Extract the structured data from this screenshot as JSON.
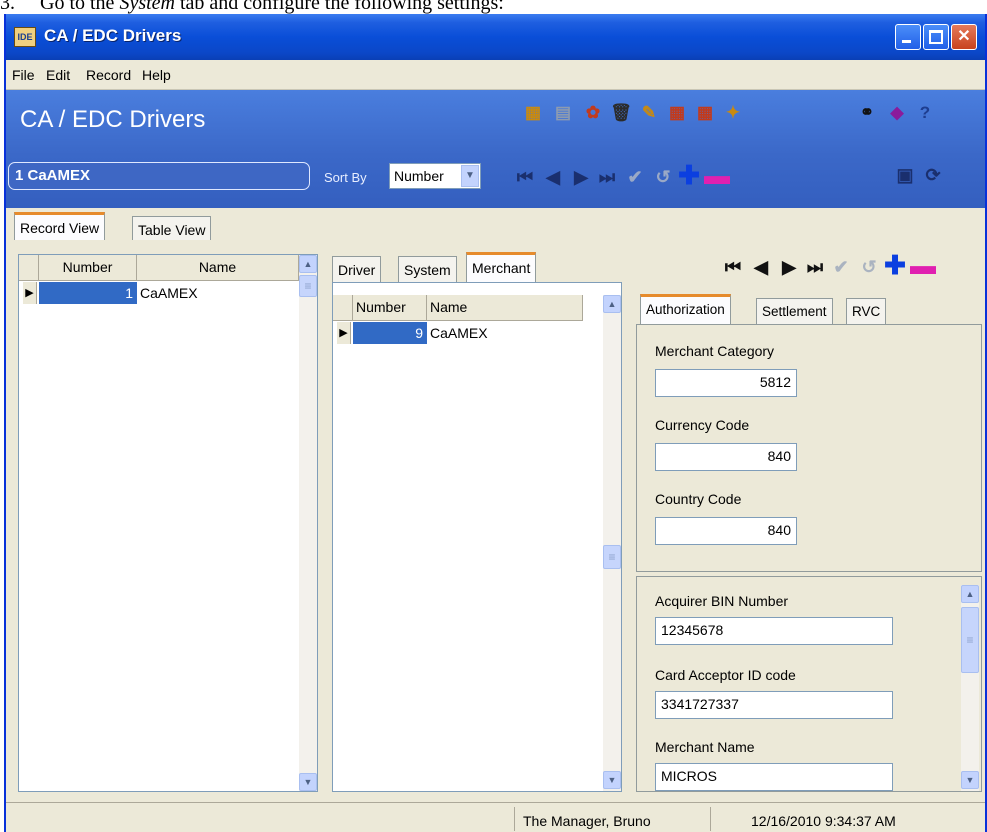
{
  "doc_caption": {
    "number": "3.",
    "before": "Go to the ",
    "italic": "System",
    "after": " tab and configure the following settings:"
  },
  "window": {
    "title": "CA / EDC Drivers",
    "icon_text": "IDE"
  },
  "menu": [
    "File",
    "Edit",
    "Record",
    "Help"
  ],
  "header": {
    "title": "CA / EDC Drivers",
    "current_record": "1 CaAMEX",
    "sort_by_label": "Sort By",
    "sort_by_value": "Number"
  },
  "view_tabs": [
    "Record View",
    "Table View"
  ],
  "left_grid": {
    "columns": [
      "Number",
      "Name"
    ],
    "rows": [
      {
        "number": "1",
        "name": "CaAMEX"
      }
    ]
  },
  "detail_tabs": [
    "Driver",
    "System",
    "Merchant"
  ],
  "merchant_grid": {
    "columns": [
      "Number",
      "Name"
    ],
    "rows": [
      {
        "number": "9",
        "name": "CaAMEX"
      }
    ]
  },
  "settings_tabs": [
    "Authorization",
    "Settlement",
    "RVC"
  ],
  "authorization": {
    "merchant_category_label": "Merchant Category",
    "merchant_category": "5812",
    "currency_code_label": "Currency Code",
    "currency_code": "840",
    "country_code_label": "Country Code",
    "country_code": "840"
  },
  "acquirer": {
    "bin_label": "Acquirer BIN Number",
    "bin": "12345678",
    "card_acceptor_label": "Card Acceptor ID code",
    "card_acceptor": "3341727337",
    "merchant_name_label": "Merchant Name",
    "merchant_name": "MICROS"
  },
  "status": {
    "user": "The Manager, Bruno",
    "datetime": "12/16/2010 9:34:37 AM"
  },
  "colors": {
    "title_bar": "#0a4ed8",
    "header_band": "#3b68c8",
    "selection": "#316ac5",
    "active_tab_accent": "#e68b2c",
    "add_icon": "#0b3fe0",
    "delete_icon": "#e020b0"
  }
}
